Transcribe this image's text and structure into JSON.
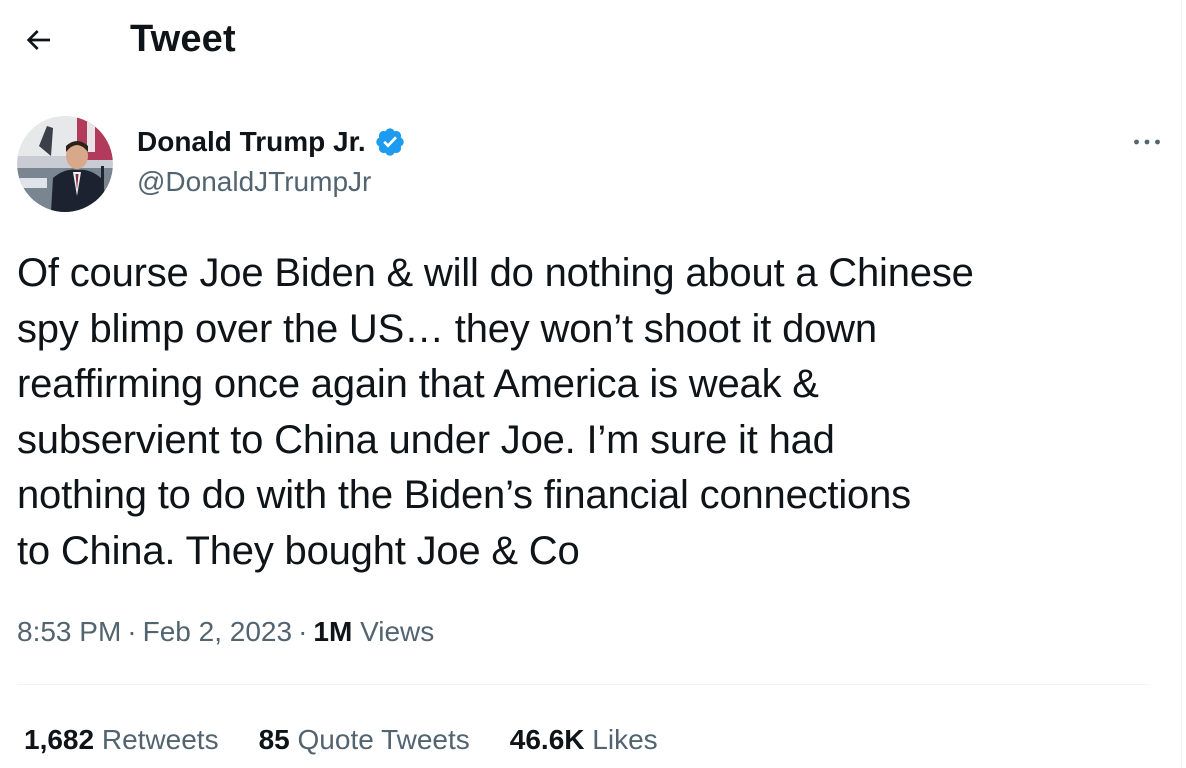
{
  "header": {
    "title": "Tweet",
    "back_icon": "arrow-left-icon"
  },
  "author": {
    "display_name": "Donald Trump Jr.",
    "handle": "@DonaldJTrumpJr",
    "verified_icon": "verified-badge-icon",
    "more_icon": "more-horizontal-icon"
  },
  "tweet": {
    "text": "Of course Joe Biden & will do nothing about a Chinese\nspy blimp over the US… they won’t shoot it down\nreaffirming once again that America is weak &\nsubservient to China under Joe. I’m sure it had\nnothing to do with the Biden’s financial connections\nto China. They bought Joe & Co"
  },
  "meta": {
    "time": "8:53 PM",
    "separator": "·",
    "date": "Feb 2, 2023",
    "views_count": "1M",
    "views_label": "Views"
  },
  "stats": {
    "retweets_count": "1,682",
    "retweets_label": "Retweets",
    "quotes_count": "85",
    "quotes_label": "Quote Tweets",
    "likes_count": "46.6K",
    "likes_label": "Likes"
  },
  "colors": {
    "primary_text": "#0f1419",
    "secondary_text": "#536471",
    "verified_blue": "#1d9bf0",
    "divider": "#eff3f4"
  }
}
